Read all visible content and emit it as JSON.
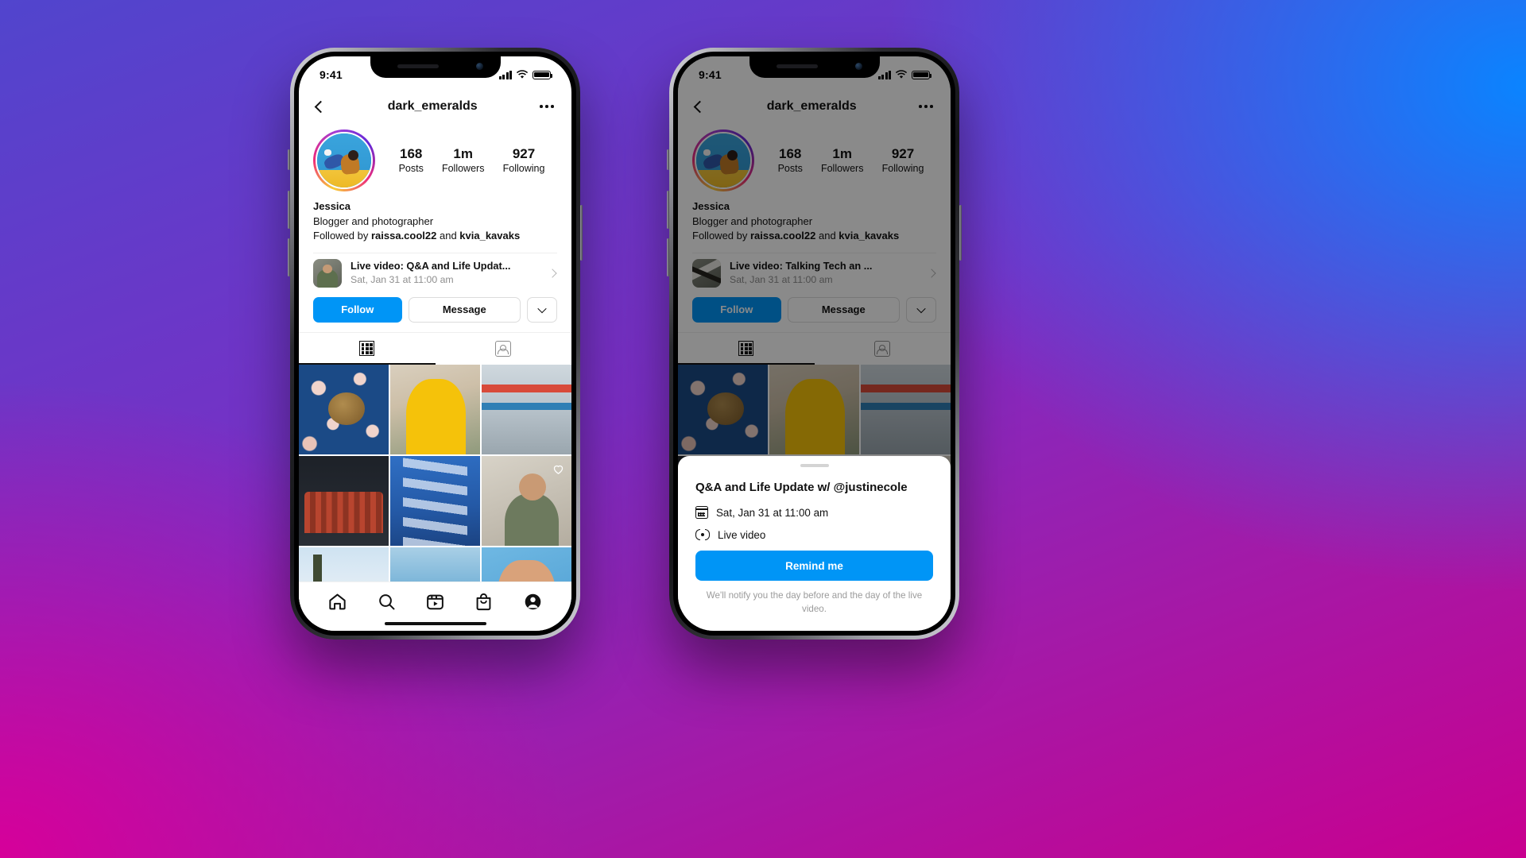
{
  "background": {
    "gradient_from": "#5145cd",
    "gradient_mid": "#a31aa8",
    "gradient_to": "#c9008f",
    "accent_blue": "#0a84ff"
  },
  "status_bar": {
    "time": "9:41",
    "signal_icon": "cellular-bars-icon",
    "wifi_icon": "wifi-icon",
    "battery_icon": "battery-icon"
  },
  "phone_left": {
    "header": {
      "back_icon": "chevron-left-icon",
      "title": "dark_emeralds",
      "more_icon": "ellipsis-icon"
    },
    "avatar": {
      "icon": "profile-avatar",
      "has_story_ring": true
    },
    "stats": [
      {
        "num": "168",
        "label": "Posts"
      },
      {
        "num": "1m",
        "label": "Followers"
      },
      {
        "num": "927",
        "label": "Following"
      }
    ],
    "bio": {
      "name": "Jessica",
      "description": "Blogger and photographer",
      "followed_by_prefix": "Followed by ",
      "followed_by_user1": "raissa.cool22",
      "followed_by_join": " and ",
      "followed_by_user2": "kvia_kavaks"
    },
    "live_row": {
      "thumb_icon": "live-video-thumbnail",
      "title": "Live video: Q&A and Life Updat...",
      "subtitle": "Sat, Jan 31 at 11:00 am",
      "chevron_icon": "chevron-right-icon"
    },
    "actions": {
      "follow": "Follow",
      "message": "Message",
      "more_icon": "chevron-down-icon"
    },
    "grid_tabs": [
      {
        "icon": "grid-icon",
        "active": true
      },
      {
        "icon": "tagged-person-icon",
        "active": false
      }
    ],
    "tabbar": [
      {
        "icon": "home-icon",
        "active": false
      },
      {
        "icon": "search-icon",
        "active": false
      },
      {
        "icon": "reels-icon",
        "active": false
      },
      {
        "icon": "shop-bag-icon",
        "active": false
      },
      {
        "icon": "profile-icon",
        "active": true
      }
    ]
  },
  "phone_right": {
    "header": {
      "back_icon": "chevron-left-icon",
      "title": "dark_emeralds",
      "more_icon": "ellipsis-icon"
    },
    "stats": [
      {
        "num": "168",
        "label": "Posts"
      },
      {
        "num": "1m",
        "label": "Followers"
      },
      {
        "num": "927",
        "label": "Following"
      }
    ],
    "bio": {
      "name": "Jessica",
      "description": "Blogger and photographer",
      "followed_by_prefix": "Followed by ",
      "followed_by_user1": "raissa.cool22",
      "followed_by_join": " and ",
      "followed_by_user2": "kvia_kavaks"
    },
    "live_row": {
      "thumb_icon": "live-video-thumbnail",
      "title": "Live video: Talking Tech an ...",
      "subtitle": "Sat, Jan 31 at 11:00 am",
      "chevron_icon": "chevron-right-icon"
    },
    "actions": {
      "follow": "Follow",
      "message": "Message",
      "more_icon": "chevron-down-icon"
    },
    "sheet": {
      "grabber_icon": "drag-handle",
      "title": "Q&A and Life Update w/ @justinecole",
      "date_icon": "calendar-icon",
      "date": "Sat, Jan 31 at 11:00 am",
      "type_icon": "live-broadcast-icon",
      "type": "Live video",
      "button": "Remind me",
      "note": "We'll notify you the day before and the day of the live video."
    }
  }
}
